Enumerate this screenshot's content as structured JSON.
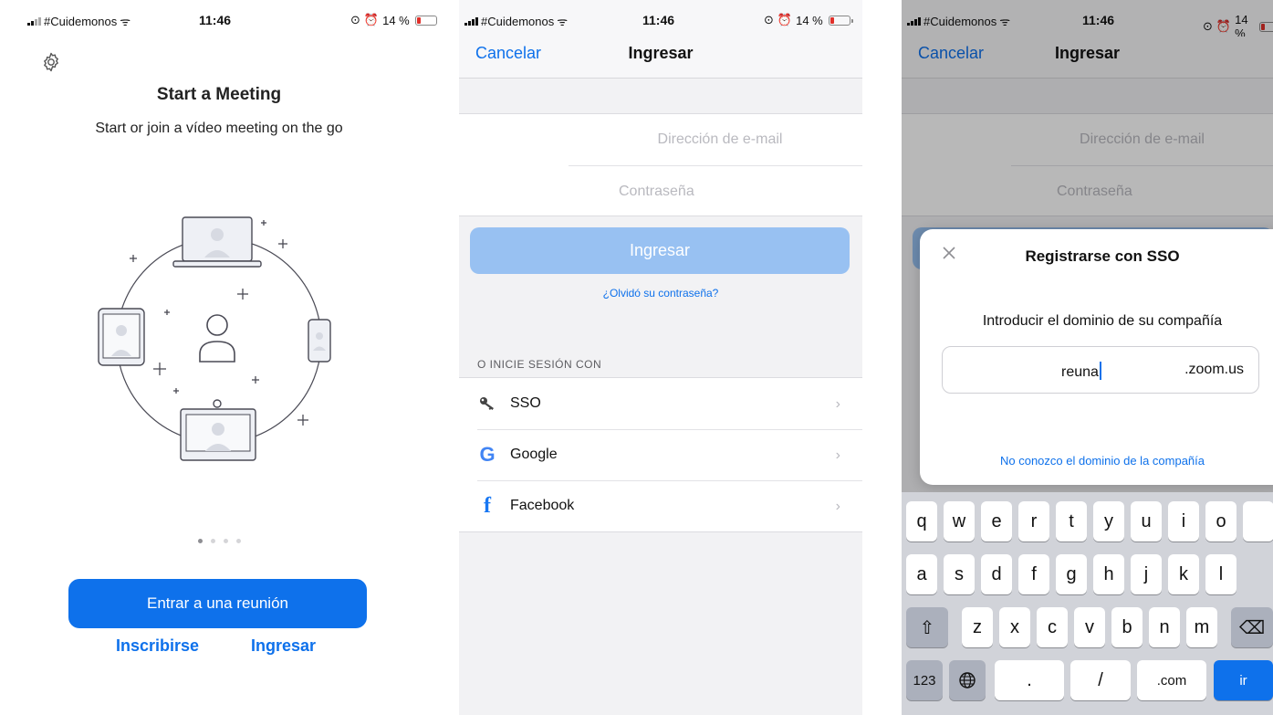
{
  "screens": {
    "start": {
      "status": {
        "carrier": "#Cuidemonos",
        "time": "11:46",
        "battery": "14 %"
      },
      "title": "Start a Meeting",
      "subtitle": "Start or join a vídeo meeting on the go",
      "join_button": "Entrar a una reunión",
      "signup_link": "Inscribirse",
      "signin_link": "Ingresar",
      "page_dots": 4,
      "active_dot": 1
    },
    "login": {
      "status": {
        "carrier": "#Cuidemonos",
        "time": "11:46",
        "battery": "14 %"
      },
      "nav": {
        "cancel": "Cancelar",
        "title": "Ingresar"
      },
      "email_placeholder": "Dirección de e-mail",
      "password_placeholder": "Contraseña",
      "signin_button": "Ingresar",
      "forgot_link": "¿Olvidó su contraseña?",
      "section_label": "O INICIE SESIÓN CON",
      "providers": [
        {
          "label": "SSO",
          "icon": "key-icon"
        },
        {
          "label": "Google",
          "icon": "google-icon"
        },
        {
          "label": "Facebook",
          "icon": "facebook-icon"
        }
      ]
    },
    "sso": {
      "status": {
        "carrier": "#Cuidemonos",
        "time": "11:46",
        "battery": "14 %"
      },
      "nav": {
        "cancel": "Cancelar",
        "title": "Ingresar"
      },
      "email_placeholder": "Dirección de e-mail",
      "password_placeholder": "Contraseña",
      "modal": {
        "title": "Registrarse con SSO",
        "prompt": "Introducir el dominio de su compañía",
        "domain_value": "reuna",
        "domain_suffix": ".zoom.us",
        "unknown_link": "No conozco el dominio de la compañía"
      },
      "keyboard": {
        "row1": [
          "q",
          "w",
          "e",
          "r",
          "t",
          "y",
          "u",
          "i",
          "o"
        ],
        "row2": [
          "a",
          "s",
          "d",
          "f",
          "g",
          "h",
          "j",
          "k",
          "l"
        ],
        "row3": [
          "z",
          "x",
          "c",
          "v",
          "b",
          "n",
          "m"
        ],
        "bottom": {
          "numbers": "123",
          "dot": ".",
          "slash": "/",
          "com": ".com",
          "go": "ir"
        }
      }
    }
  },
  "colors": {
    "accent": "#0e71eb",
    "disabled_button": "#98c1f2",
    "keyboard_bg": "#d1d3d9"
  }
}
